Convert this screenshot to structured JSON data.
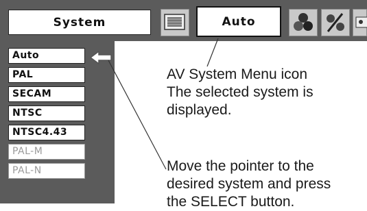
{
  "menubar": {
    "system_label": "System",
    "selected_value": "Auto",
    "icons": [
      "screen-icon",
      "av-system-icon",
      "color-adjust-icon",
      "image-adjust-icon",
      "setting-icon"
    ]
  },
  "system_list": {
    "items": [
      {
        "label": "Auto",
        "enabled": true,
        "selected": true
      },
      {
        "label": "PAL",
        "enabled": true
      },
      {
        "label": "SECAM",
        "enabled": true
      },
      {
        "label": "NTSC",
        "enabled": true
      },
      {
        "label": "NTSC4.43",
        "enabled": true
      },
      {
        "label": "PAL-M",
        "enabled": false
      },
      {
        "label": "PAL-N",
        "enabled": false
      }
    ]
  },
  "callouts": {
    "menu_icon": {
      "lines": [
        "AV System Menu icon",
        "The selected system is",
        "displayed."
      ]
    },
    "pointer": {
      "lines": [
        "Move the pointer to the",
        "desired system and press",
        "the SELECT button."
      ]
    }
  },
  "colors": {
    "panel": "#5b5b5b",
    "box": "#ffffff",
    "disabled_text": "#9a9a9a"
  }
}
